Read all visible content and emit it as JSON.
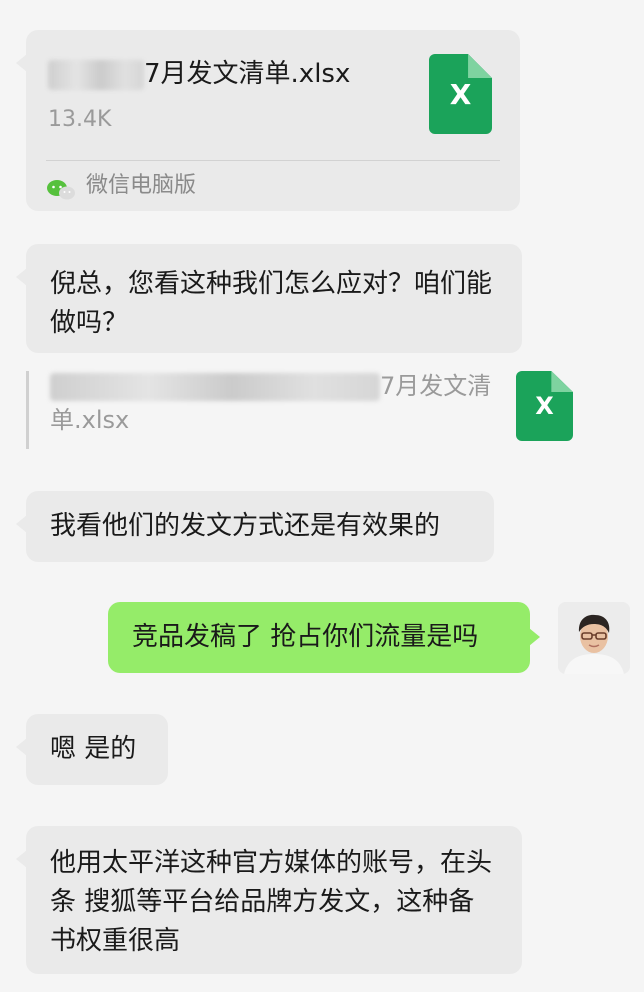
{
  "file_card": {
    "filename_visible": "7月发文清单.xlsx",
    "size": "13.4K",
    "source": "微信电脑版",
    "icon_letter": "X",
    "icon": "excel-file-icon",
    "source_icon": "wechat-icon"
  },
  "messages": [
    {
      "side": "in",
      "text": "倪总，您看这种我们怎么应对？咱们能做吗？"
    },
    {
      "side": "in",
      "text": "我看他们的发文方式还是有效果的"
    },
    {
      "side": "out",
      "text": "竞品发稿了 抢占你们流量是吗"
    },
    {
      "side": "in",
      "text": "嗯 是的"
    },
    {
      "side": "in",
      "text": "他用太平洋这种官方媒体的账号，在头条 搜狐等平台给品牌方发文，这种备书权重很高"
    }
  ],
  "quote": {
    "text_line1": "7月发文清",
    "text_line2": "单.xlsx",
    "icon_letter": "X"
  },
  "colors": {
    "background": "#f5f5f5",
    "incoming_bubble": "#eaeaea",
    "outgoing_bubble": "#95ec69",
    "excel_green": "#1ba35a"
  }
}
